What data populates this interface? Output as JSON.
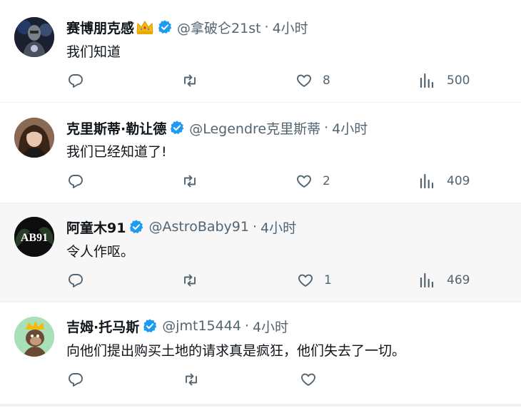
{
  "tweets": [
    {
      "name": "赛博朋克感",
      "emoji": "crown-emoji",
      "verified": true,
      "handle": "@拿破仑21st",
      "sep": "·",
      "time": "4小时",
      "text": "我们知道",
      "replies": "",
      "retweets": "",
      "likes": "8",
      "views": "500",
      "avatar": "cyberpunk-figure-avatar"
    },
    {
      "name": "克里斯蒂·勒让德",
      "verified": true,
      "handle": "@Legendre克里斯蒂",
      "sep": "·",
      "time": "4小时",
      "text": "我们已经知道了!",
      "replies": "",
      "retweets": "",
      "likes": "2",
      "views": "409",
      "avatar": "woman-portrait-avatar"
    },
    {
      "name": "阿童木91",
      "verified": true,
      "handle": "@AstroBaby91",
      "sep": "·",
      "time": "4小时",
      "text": "令人作呕。",
      "replies": "",
      "retweets": "",
      "likes": "1",
      "views": "469",
      "avatar": "ab91-logo-avatar",
      "avatar_text": "AB91"
    },
    {
      "name": "吉姆·托马斯",
      "verified": true,
      "handle": "@jmt15444",
      "sep": "·",
      "time": "4小时",
      "text": "向他们提出购买土地的请求真是疯狂，他们失去了一切。",
      "replies": "",
      "retweets": "",
      "likes": "",
      "views": "",
      "avatar": "ape-nft-avatar"
    }
  ],
  "colors": {
    "verified": "#1d9bf0",
    "muted": "#536471",
    "text": "#0f1419",
    "highlight_bg": "#f7f7f7",
    "border": "#eff3f4"
  },
  "icons": {
    "reply": "reply-icon",
    "retweet": "retweet-icon",
    "like": "heart-icon",
    "views": "views-bar-chart-icon",
    "verified": "verified-badge-icon"
  }
}
